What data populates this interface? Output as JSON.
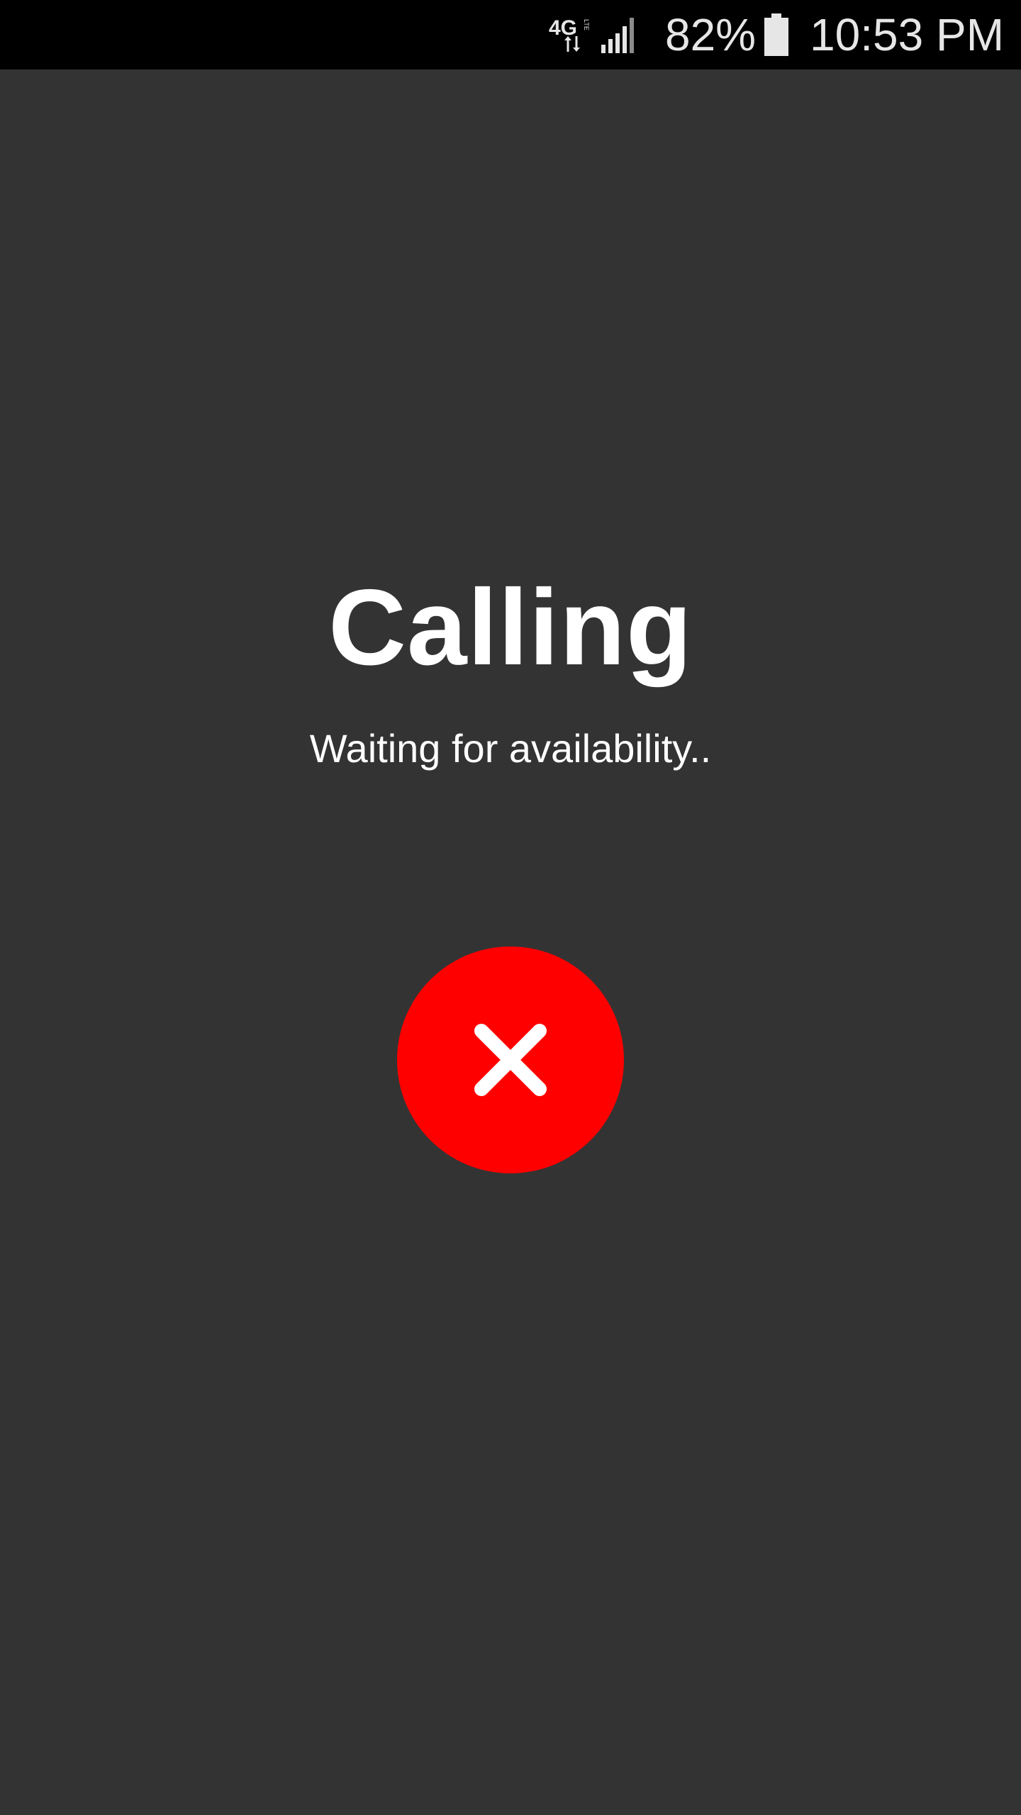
{
  "status_bar": {
    "network": "4G LTE",
    "battery_percent": "82%",
    "time": "10:53 PM"
  },
  "call": {
    "title": "Calling",
    "status": "Waiting for availability.."
  },
  "end_call": {
    "icon": "close-icon",
    "color": "#ff0000"
  },
  "colors": {
    "background": "#333333",
    "status_bar": "#000000",
    "text": "#ffffff"
  }
}
